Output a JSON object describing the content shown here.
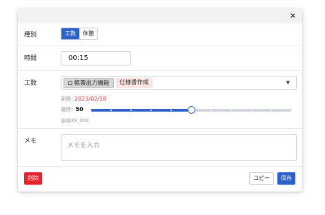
{
  "dialog": {
    "close_symbol": "×"
  },
  "type_row": {
    "label": "種別",
    "options": [
      "工数",
      "休憩"
    ],
    "selected": "工数"
  },
  "time_row": {
    "label": "時間",
    "value": "00:15"
  },
  "work_row": {
    "label": "工数",
    "tags": [
      {
        "icon": "folder-icon",
        "icon_glyph": "ロ",
        "text": "帳票出力機能"
      },
      {
        "text": "仕様書作成"
      }
    ],
    "caret_glyph": "▼",
    "deadline_label": "期限:",
    "deadline_value": "2023/02/18",
    "progress_label": "進捗:",
    "progress_value": "50",
    "assignee": "@@xx_xxx",
    "progress_fraction": 0.5
  },
  "memo_row": {
    "label": "メモ",
    "placeholder": "メモを入力"
  },
  "footer": {
    "delete_label": "削除",
    "copy_label": "コピー",
    "save_label": "保存"
  },
  "colors": {
    "accent": "#2e60cc",
    "danger": "#e8232e",
    "deadline": "#e0303a",
    "tag_pink": "#fde4e4"
  }
}
